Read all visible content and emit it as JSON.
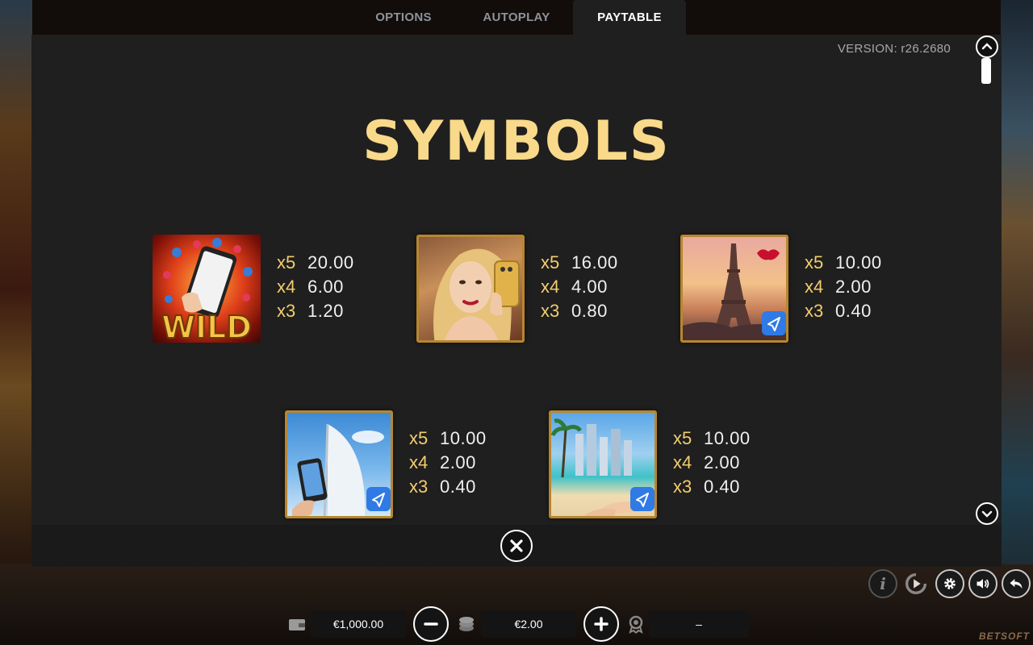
{
  "tabs": [
    {
      "label": "OPTIONS",
      "active": false
    },
    {
      "label": "AUTOPLAY",
      "active": false
    },
    {
      "label": "PAYTABLE",
      "active": true
    }
  ],
  "version": "VERSION: r26.2680",
  "section_title": "SYMBOLS",
  "symbols": [
    {
      "name": "wild-phone-symbol",
      "label": "WILD",
      "pays": [
        {
          "mult": "x5",
          "value": "20.00"
        },
        {
          "mult": "x4",
          "value": "6.00"
        },
        {
          "mult": "x3",
          "value": "1.20"
        }
      ]
    },
    {
      "name": "woman-selfie-symbol",
      "pays": [
        {
          "mult": "x5",
          "value": "16.00"
        },
        {
          "mult": "x4",
          "value": "4.00"
        },
        {
          "mult": "x3",
          "value": "0.80"
        }
      ]
    },
    {
      "name": "eiffel-tower-symbol",
      "pays": [
        {
          "mult": "x5",
          "value": "10.00"
        },
        {
          "mult": "x4",
          "value": "2.00"
        },
        {
          "mult": "x3",
          "value": "0.40"
        }
      ]
    },
    {
      "name": "burj-al-arab-symbol",
      "pays": [
        {
          "mult": "x5",
          "value": "10.00"
        },
        {
          "mult": "x4",
          "value": "2.00"
        },
        {
          "mult": "x3",
          "value": "0.40"
        }
      ]
    },
    {
      "name": "beach-skyline-symbol",
      "pays": [
        {
          "mult": "x5",
          "value": "10.00"
        },
        {
          "mult": "x4",
          "value": "2.00"
        },
        {
          "mult": "x3",
          "value": "0.40"
        }
      ]
    }
  ],
  "controls": {
    "info_icon": "i",
    "balance": "€1,000.00",
    "bet": "€2.00",
    "win": "–"
  },
  "brand": "BETSOFT",
  "colors": {
    "title": "#f9d98a",
    "multiplier": "#f3cd6e",
    "tile_border": "#b8862e"
  }
}
